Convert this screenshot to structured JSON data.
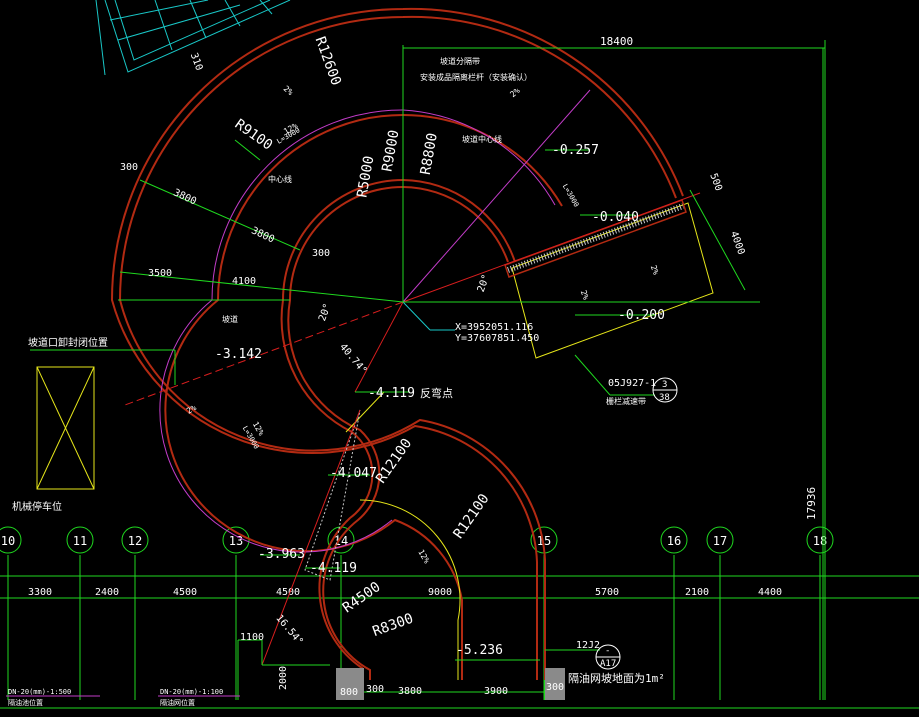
{
  "colors": {
    "background": "#000000",
    "wall": "#b22a12",
    "dimension": "#1fd81f",
    "text": "#ffffff",
    "axis_red": "#d81e1e",
    "yellow": "#e6e61a",
    "magenta": "#c23cc8",
    "cyan": "#19c8c8",
    "axis_bubble": "#1fd81f"
  },
  "radius_labels": {
    "r12600": "R12600",
    "r9100": "R9100",
    "r9000": "R9000",
    "r8800": "R8800",
    "r5000": "R5000",
    "r12100_a": "R12100",
    "r12100_b": "R12100",
    "r4500": "R4500",
    "r8300": "R8300"
  },
  "elevations": {
    "e0257": "-0.257",
    "e0040": "-0.040",
    "e0200": "-0.200",
    "e3142": "-3.142",
    "e4119a": "-4.119",
    "e4047": "-4.047",
    "e3963": "-3.963",
    "e4119b": "-4.119",
    "e5236": "-5.236"
  },
  "dims": {
    "d18400": "18400",
    "d17936": "17936",
    "d310": "310",
    "d300a": "300",
    "d3800a": "3800",
    "d3800b": "3800",
    "d300b": "300",
    "d3500": "3500",
    "d4100": "4100",
    "d500": "500",
    "d4000": "4000",
    "d1100": "1100",
    "d2000": "2000",
    "d800": "800",
    "d300c": "300",
    "d300d": "300"
  },
  "angles": {
    "a20a": "20°",
    "a20b": "20°",
    "a4074": "40.74°",
    "a1654": "16.54°"
  },
  "coords": {
    "x": "X=3952051.116",
    "y": "Y=37607851.450"
  },
  "notes": {
    "sign_top": "坡道分隔带",
    "sign_top2": "安装成品隔离栏杆（安装确认）",
    "center_line": "坡道中心线",
    "center_line2": "中心线",
    "slope": "坡道",
    "slope_note": "坡道口卸封闭位置",
    "parking": "机械停车位",
    "detail_ref": "05J927-1",
    "detail_num": "3",
    "detail_sheet": "38",
    "detail_caption": "栅栏减速带",
    "inflection": "反弯点",
    "drain_note": "隔油网坡地面为1m²",
    "detail2_ref": "12J2",
    "detail2_num": "-",
    "detail2_sheet": "A17",
    "slope_pct_1": "2%",
    "slope_pct_2": "2%",
    "slope_pct_3": "2%",
    "slope_pct_4": "12%",
    "slope_pct_5": "12%",
    "slope_pct_6": "12%",
    "slope_pct_7": "2%",
    "slope_pct_8": "2%",
    "ramp_len_1": "L=3000",
    "ramp_len_2": "L=3000",
    "ramp_len_3": "L=3000",
    "legend_a": "DN-20(mm)-1:500",
    "legend_b": "DN-20(mm)-1:100",
    "legend_c": "隔油池位置",
    "legend_d": "隔油网位置"
  },
  "grid_axes": [
    "10",
    "11",
    "12",
    "13",
    "14",
    "15",
    "16",
    "17",
    "18"
  ],
  "bay_dims": [
    "3300",
    "2400",
    "4500",
    "4500",
    "9000",
    "5700",
    "2100",
    "4400"
  ],
  "bottom_dims": {
    "b3800": "3800",
    "b3900": "3900"
  }
}
